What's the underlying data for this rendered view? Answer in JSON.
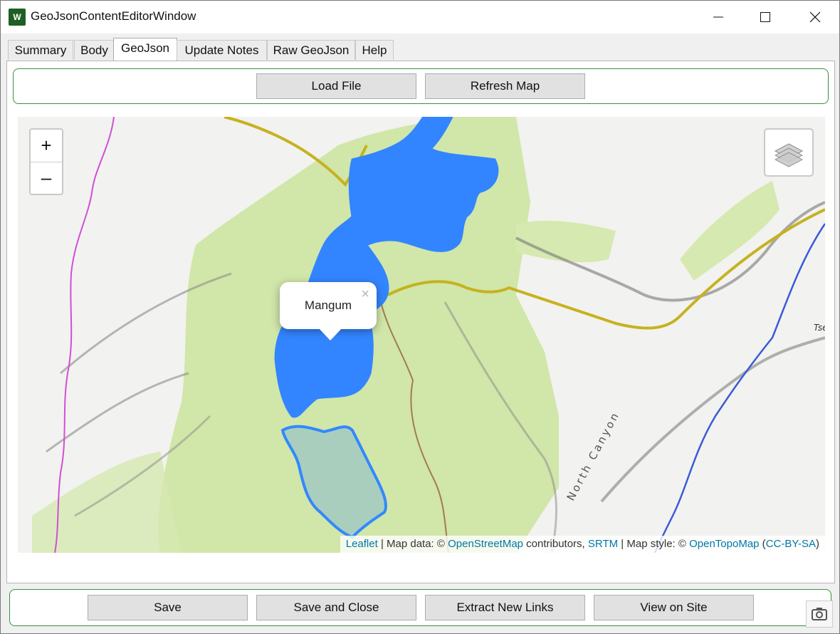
{
  "window": {
    "title": "GeoJsonContentEditorWindow",
    "app_icon_text": "W"
  },
  "tabs": [
    {
      "label": "Summary"
    },
    {
      "label": "Body"
    },
    {
      "label": "GeoJson",
      "active": true
    },
    {
      "label": "Update Notes"
    },
    {
      "label": "Raw GeoJson"
    },
    {
      "label": "Help"
    }
  ],
  "toolbar": {
    "load_file_label": "Load File",
    "refresh_map_label": "Refresh Map"
  },
  "map": {
    "zoom_in_label": "+",
    "zoom_out_label": "–",
    "layers_icon": "layers-icon",
    "popup": {
      "text": "Mangum",
      "close": "×"
    },
    "feature_fill_color": "#3385ff",
    "outline_color": "#3388ff",
    "labels": {
      "canyon": "North Canyon",
      "edge": "Tse"
    },
    "attribution": {
      "leaflet": "Leaflet",
      "sep1": " | Map data: © ",
      "osm": "OpenStreetMap",
      "contrib": " contributors, ",
      "srtm": "SRTM",
      "sep2": " | Map style: © ",
      "opentopomap": "OpenTopoMap",
      "open_paren": " (",
      "license": "CC-BY-SA",
      "close_paren": ")"
    }
  },
  "bottom_bar": {
    "save_label": "Save",
    "save_close_label": "Save and Close",
    "extract_links_label": "Extract New Links",
    "view_site_label": "View on Site"
  },
  "camera_icon": "camera-icon"
}
